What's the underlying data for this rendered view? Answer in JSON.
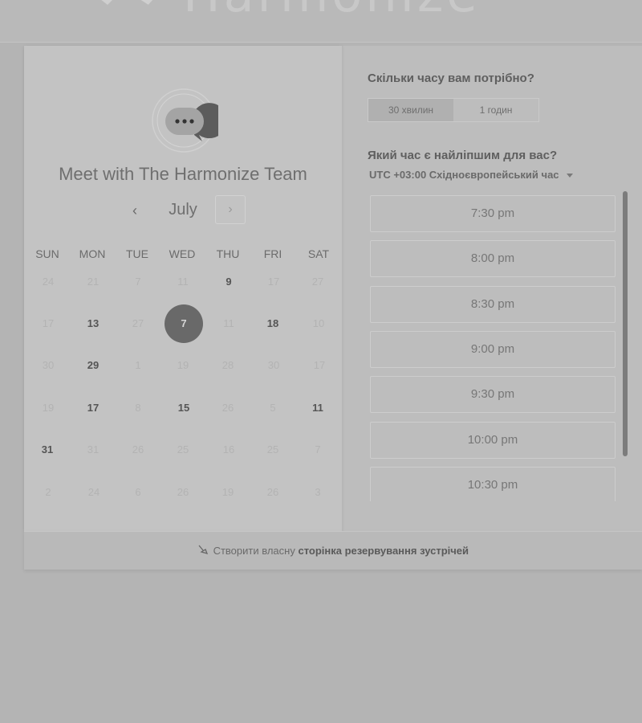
{
  "brand": {
    "name": "Harmonize"
  },
  "scheduler": {
    "title": "Meet with The Harmonize Team",
    "month": "July",
    "prev_symbol": "‹",
    "next_symbol": "›",
    "weekdays": [
      "SUN",
      "MON",
      "TUE",
      "WED",
      "THU",
      "FRI",
      "SAT"
    ],
    "weeks": [
      [
        "24",
        "21",
        "7",
        "11",
        "9",
        "17",
        "27"
      ],
      [
        "17",
        "13",
        "27",
        "7",
        "11",
        "18",
        "10"
      ],
      [
        "30",
        "29",
        "1",
        "19",
        "28",
        "30",
        "17"
      ],
      [
        "19",
        "17",
        "8",
        "15",
        "26",
        "5",
        "11"
      ],
      [
        "31",
        "31",
        "26",
        "25",
        "16",
        "25",
        "7"
      ],
      [
        "2",
        "24",
        "6",
        "26",
        "19",
        "26",
        "3"
      ]
    ],
    "selected_date": "7"
  },
  "duration": {
    "question": "Скільки часу вам потрібно?",
    "options": [
      "30 хвилин",
      "1 годин"
    ],
    "selected": "30 хвилин"
  },
  "time": {
    "question": "Який час є найліпшим для вас?",
    "timezone_offset": "UTC +03:00",
    "timezone_name": "Східноєвропейський час",
    "slots": [
      "7:30 pm",
      "8:00 pm",
      "8:30 pm",
      "9:00 pm",
      "9:30 pm",
      "10:00 pm",
      "10:30 pm"
    ]
  },
  "footer": {
    "prefix": "Створити власну",
    "link": "сторінка резервування зустрічей"
  }
}
